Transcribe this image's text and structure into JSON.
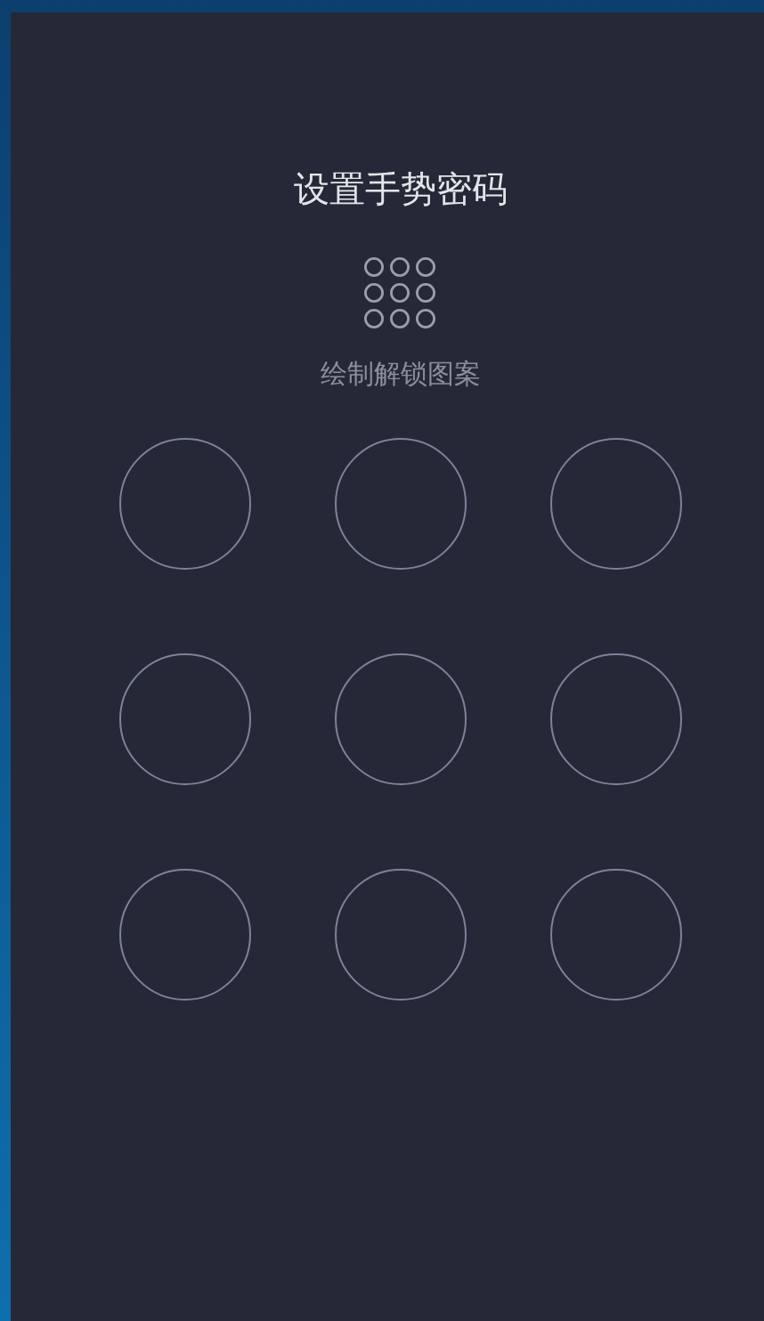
{
  "title": "设置手势密码",
  "subtitle": "绘制解锁图案",
  "pattern": {
    "nodes": [
      {
        "selected": false
      },
      {
        "selected": false
      },
      {
        "selected": false
      },
      {
        "selected": false
      },
      {
        "selected": false
      },
      {
        "selected": false
      },
      {
        "selected": false
      },
      {
        "selected": false
      },
      {
        "selected": false
      }
    ]
  }
}
